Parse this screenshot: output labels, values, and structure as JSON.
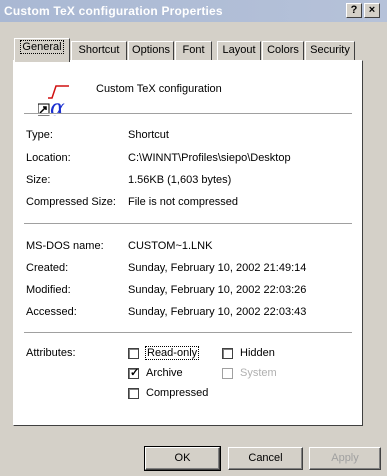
{
  "window": {
    "title": "Custom TeX configuration Properties",
    "help_label": "?",
    "close_label": "×"
  },
  "tabs": [
    {
      "label": "General",
      "active": true
    },
    {
      "label": "Shortcut",
      "active": false
    },
    {
      "label": "Options",
      "active": false
    },
    {
      "label": "Font",
      "active": false
    },
    {
      "label": "Layout",
      "active": false
    },
    {
      "label": "Colors",
      "active": false
    },
    {
      "label": "Security",
      "active": false
    }
  ],
  "general": {
    "app_name": "Custom TeX configuration",
    "icon_glyph": "α",
    "fields1": [
      {
        "label": "Type:",
        "value": "Shortcut"
      },
      {
        "label": "Location:",
        "value": "C:\\WINNT\\Profiles\\siepo\\Desktop"
      },
      {
        "label": "Size:",
        "value": "1.56KB (1,603 bytes)"
      },
      {
        "label": "Compressed Size:",
        "value": "File is not compressed"
      }
    ],
    "fields2": [
      {
        "label": "MS-DOS name:",
        "value": "CUSTOM~1.LNK"
      },
      {
        "label": "Created:",
        "value": "Sunday, February 10, 2002 21:49:14"
      },
      {
        "label": "Modified:",
        "value": "Sunday, February 10, 2002 22:03:26"
      },
      {
        "label": "Accessed:",
        "value": "Sunday, February 10, 2002 22:03:43"
      }
    ],
    "attributes_label": "Attributes:",
    "attributes": {
      "read_only": {
        "label": "Read-only",
        "checked": false,
        "enabled": true
      },
      "hidden": {
        "label": "Hidden",
        "checked": false,
        "enabled": true
      },
      "archive": {
        "label": "Archive",
        "checked": true,
        "enabled": true
      },
      "system": {
        "label": "System",
        "checked": false,
        "enabled": false
      },
      "compressed": {
        "label": "Compressed",
        "checked": false,
        "enabled": true
      }
    }
  },
  "buttons": {
    "ok": "OK",
    "cancel": "Cancel",
    "apply": "Apply"
  },
  "colors": {
    "titlebar_start": "#a9b8d3",
    "titlebar_end": "#b6c2d9",
    "dialog_bg": "#d4d0c8",
    "panel_bg": "#ffffff",
    "icon_accent": "#1a2fd0",
    "icon_red": "#d01010"
  }
}
